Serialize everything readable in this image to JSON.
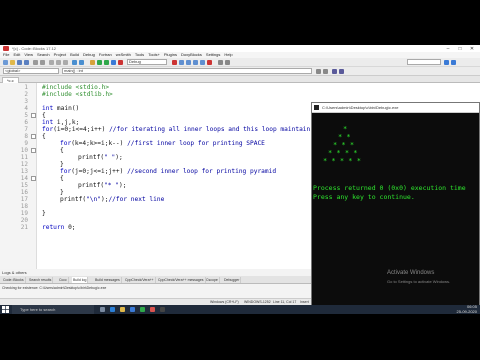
{
  "window": {
    "title": "*[c] - Code::Blocks 17.12",
    "menu": [
      "File",
      "Edit",
      "View",
      "Search",
      "Project",
      "Build",
      "Debug",
      "Fortran",
      "wxSmith",
      "Tools",
      "Tools+",
      "Plugins",
      "DoxyBlocks",
      "Settings",
      "Help"
    ]
  },
  "toolbar": {
    "target_combo": "Debug",
    "scope_combo": "<global>",
    "symbol_combo": "main() : int"
  },
  "editor": {
    "tab_label": "*c.c",
    "line_numbers": [
      "1",
      "2",
      "3",
      "4",
      "5",
      "6",
      "7",
      "8",
      "9",
      "10",
      "11",
      "12",
      "13",
      "14",
      "15",
      "16",
      "17",
      "18",
      "19",
      "20",
      "21"
    ],
    "lines": {
      "l1": "#include <stdio.h>",
      "l2": "#include <stdlib.h>",
      "l4_kw": "int",
      "l4_rest": " main()",
      "l5": "{",
      "l6_kw": "int",
      "l6_rest": " i,j,k;",
      "l7_kw": "for",
      "l7_code": "(i=0;i<=4;i++) ",
      "l7_cm": "//for iterating all inner loops and this loop maintain the size of pyramid",
      "l8": "{",
      "l9_kw": "for",
      "l9_code": "(k=4;k>=i;k--) ",
      "l9_cm": "//first inner loop for printing SPACE",
      "l10": "{",
      "l11_code": "printf(",
      "l11_str": "\" \"",
      "l11_end": ");",
      "l12": "}",
      "l13_kw": "for",
      "l13_code": "(j=0;j<=i;j++) ",
      "l13_cm": "//second inner loop for printing pyramid",
      "l14": "{",
      "l15_code": "printf(",
      "l15_str": "\"* \"",
      "l15_end": ");",
      "l16": "}",
      "l17_code": "printf(",
      "l17_str": "\"\\n\"",
      "l17_end": ");",
      "l17_cm": "//for next line",
      "l19": "}",
      "l21_kw": "return",
      "l21_rest": " 0;"
    }
  },
  "console": {
    "title": "C:\\Users\\admin\\Desktop\\c\\bin\\Debug\\c.exe",
    "pyramid_rows": [
      "*",
      "* *",
      "* * *",
      "* * * *",
      "* * * * *"
    ],
    "line1": "Process returned 0 (0x0)   execution time",
    "line2": "Press any key to continue."
  },
  "watermark": {
    "title": "Activate Windows",
    "subtitle": "Go to Settings to activate Windows."
  },
  "logs": {
    "title": "Logs & others",
    "tabs": [
      "Code::Blocks",
      "Search results",
      "Cccc",
      "Build log",
      "Build messages",
      "CppCheck/Vera++",
      "CppCheck/Vera++ messages",
      "Cscope",
      "Debugger"
    ],
    "line": "Checking for existence: C:\\Users\\admin\\Desktop\\c\\bin\\Debug\\c.exe"
  },
  "statusbar": {
    "enc": "Windows (CR+LF)",
    "charset": "WINDOWS-1252",
    "pos": "Line 11, Col 17",
    "mode": "Insert"
  },
  "taskbar": {
    "search_placeholder": "Type here to search",
    "time": "06:05",
    "date": "25-09-2020"
  }
}
